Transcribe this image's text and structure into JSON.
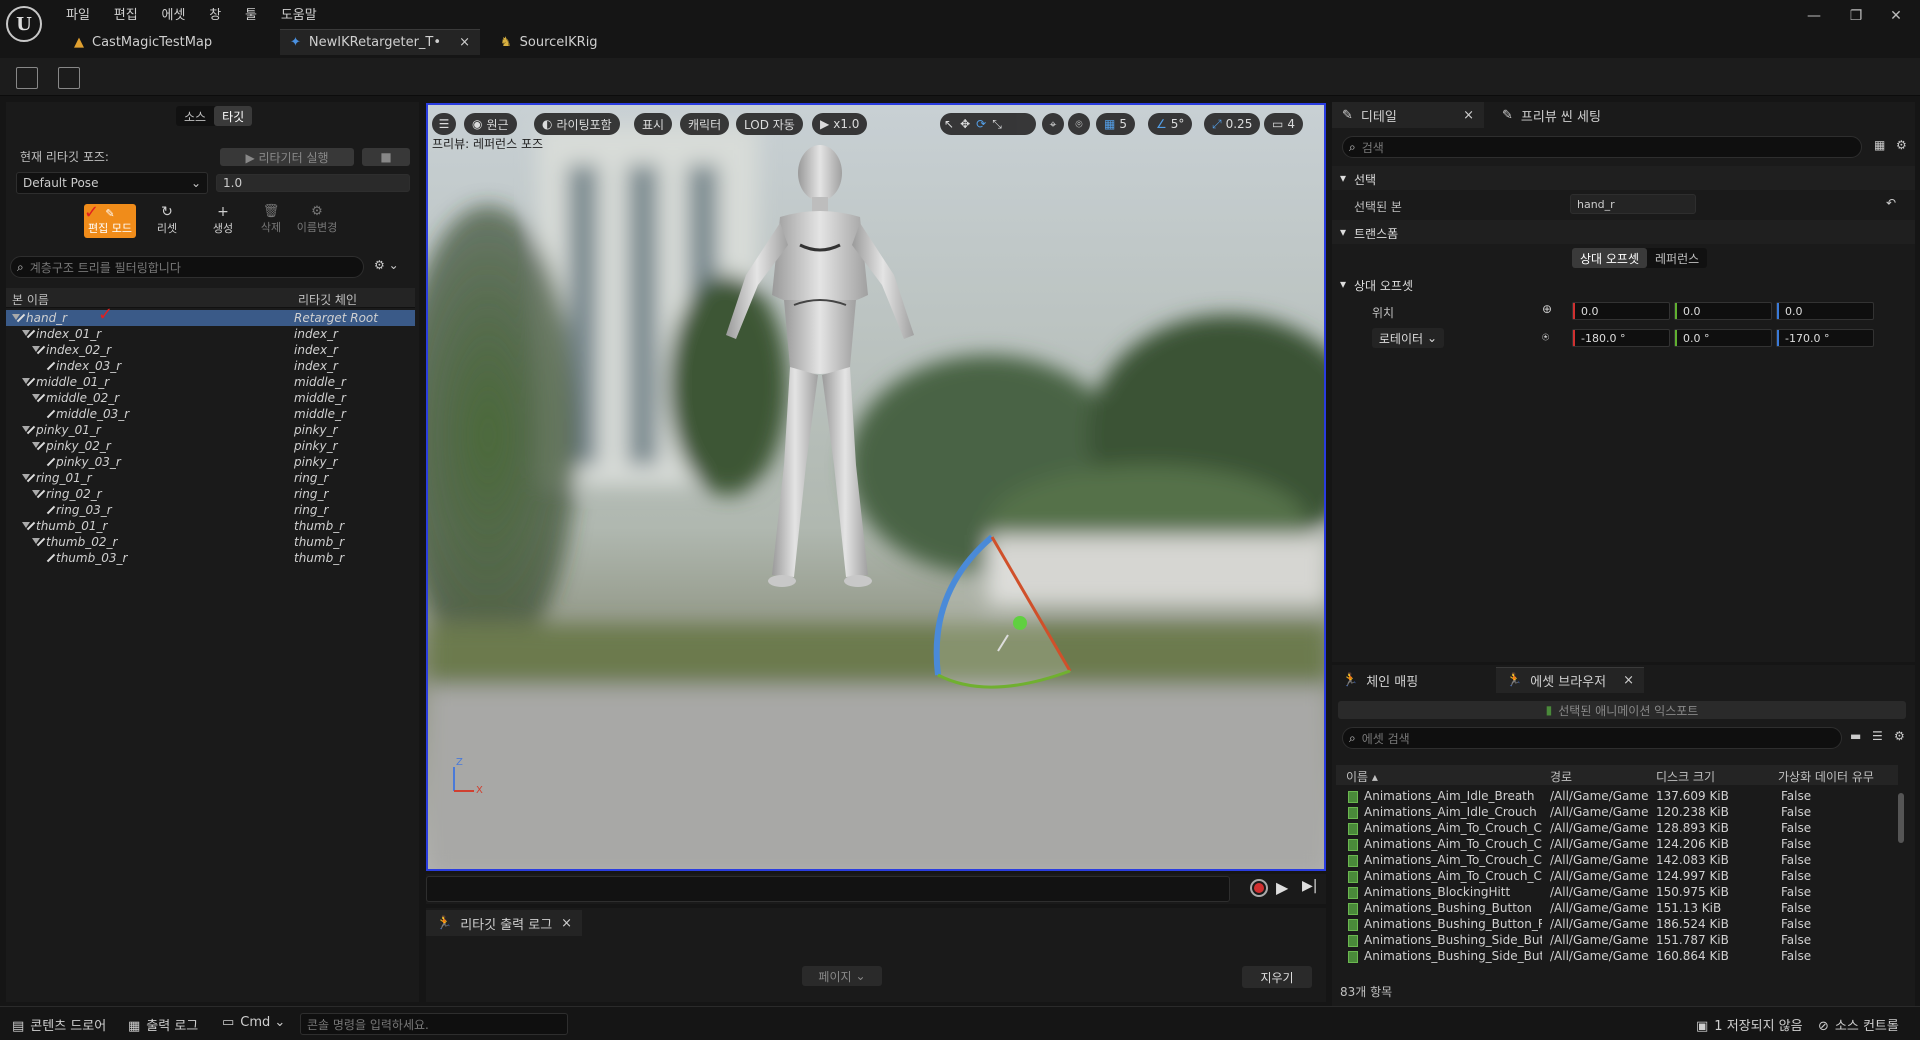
{
  "menu": [
    "파일",
    "편집",
    "에셋",
    "창",
    "툴",
    "도움말"
  ],
  "tabs": [
    {
      "label": "CastMagicTestMap",
      "close": ""
    },
    {
      "label": "NewIKRetargeter_T•",
      "close": "×"
    },
    {
      "label": "SourceIKRig",
      "close": ""
    }
  ],
  "left": {
    "tab_source": "소스",
    "tab_target": "타깃",
    "current_pose_label": "현재 리타깃 포즈:",
    "run_retargeter": "▶ 리타기터 실행",
    "pose_value": "Default Pose",
    "pose_scale": "1.0",
    "edit_mode": "편집 모드",
    "reset": "리셋",
    "create": "생성",
    "delete": "삭제",
    "rename": "이름변경",
    "filter_placeholder": "계층구조 트리를 필터링합니다",
    "col_bone": "본 이름",
    "col_chain": "리타깃 체인",
    "rows": [
      {
        "name": "hand_r",
        "chain": "Retarget Root"
      },
      {
        "name": "index_01_r",
        "chain": "index_r"
      },
      {
        "name": "index_02_r",
        "chain": "index_r"
      },
      {
        "name": "index_03_r",
        "chain": "index_r"
      },
      {
        "name": "middle_01_r",
        "chain": "middle_r"
      },
      {
        "name": "middle_02_r",
        "chain": "middle_r"
      },
      {
        "name": "middle_03_r",
        "chain": "middle_r"
      },
      {
        "name": "pinky_01_r",
        "chain": "pinky_r"
      },
      {
        "name": "pinky_02_r",
        "chain": "pinky_r"
      },
      {
        "name": "pinky_03_r",
        "chain": "pinky_r"
      },
      {
        "name": "ring_01_r",
        "chain": "ring_r"
      },
      {
        "name": "ring_02_r",
        "chain": "ring_r"
      },
      {
        "name": "ring_03_r",
        "chain": "ring_r"
      },
      {
        "name": "thumb_01_r",
        "chain": "thumb_r"
      },
      {
        "name": "thumb_02_r",
        "chain": "thumb_r"
      },
      {
        "name": "thumb_03_r",
        "chain": "thumb_r"
      }
    ]
  },
  "viewport": {
    "perspective": "원근",
    "lighting": "라이팅포함",
    "show": "표시",
    "character": "캐릭터",
    "lod": "LOD 자동",
    "speed": "x1.0",
    "grid": "5",
    "angle": "5°",
    "scale": "0.25",
    "camera": "4",
    "preview_label": "프리뷰: 레퍼런스 포즈",
    "axis_z": "Z",
    "axis_x": "X"
  },
  "log": {
    "tab": "리타깃 출력 로그",
    "close": "×",
    "page": "페이지",
    "clear": "지우기"
  },
  "details": {
    "tab": "디테일",
    "close": "×",
    "tab2": "프리뷰 씬 세팅",
    "search": "검색",
    "sec_select": "선택",
    "selected_bone_label": "선택된 본",
    "selected_bone": "hand_r",
    "sec_transform": "트랜스폼",
    "relative": "상대 오프셋",
    "reference": "레퍼런스",
    "sec_relative": "상대 오프셋",
    "location": "위치",
    "loc": [
      "0.0",
      "0.0",
      "0.0"
    ],
    "rotator": "로테이터",
    "rot": [
      "-180.0 °",
      "0.0 °",
      "-170.0 °"
    ]
  },
  "assets": {
    "tab1": "체인 매핑",
    "tab2": "에셋 브라우저",
    "close": "×",
    "export": "선택된 애니메이션 익스포트",
    "search": "에셋 검색",
    "cols": [
      "이름",
      "경로",
      "디스크 크기",
      "가상화 데이터 유무"
    ],
    "rows": [
      [
        "Animations_Aim_Idle_Breath",
        "/All/Game/Game",
        "137.609 KiB",
        "False"
      ],
      [
        "Animations_Aim_Idle_Crouch",
        "/All/Game/Game",
        "120.238 KiB",
        "False"
      ],
      [
        "Animations_Aim_To_Crouch_Cc",
        "/All/Game/Game",
        "128.893 KiB",
        "False"
      ],
      [
        "Animations_Aim_To_Crouch_Cc",
        "/All/Game/Game",
        "124.206 KiB",
        "False"
      ],
      [
        "Animations_Aim_To_Crouch_Cc",
        "/All/Game/Game",
        "142.083 KiB",
        "False"
      ],
      [
        "Animations_Aim_To_Crouch_Cc",
        "/All/Game/Game",
        "124.997 KiB",
        "False"
      ],
      [
        "Animations_BlockingHitt",
        "/All/Game/Game",
        "150.975 KiB",
        "False"
      ],
      [
        "Animations_Bushing_Button",
        "/All/Game/Game",
        "151.13 KiB",
        "False"
      ],
      [
        "Animations_Bushing_Button_Ri",
        "/All/Game/Game",
        "186.524 KiB",
        "False"
      ],
      [
        "Animations_Bushing_Side_Butt",
        "/All/Game/Game",
        "151.787 KiB",
        "False"
      ],
      [
        "Animations_Bushing_Side_Butt",
        "/All/Game/Game",
        "160.864 KiB",
        "False"
      ]
    ],
    "count": "83개 항목"
  },
  "status": {
    "content_drawer": "콘텐츠 드로어",
    "output_log": "출력 로그",
    "cmd": "Cmd",
    "console_placeholder": "콘솔 명령을 입력하세요.",
    "unsaved": "1 저장되지 않음",
    "source_control": "소스 컨트롤"
  }
}
